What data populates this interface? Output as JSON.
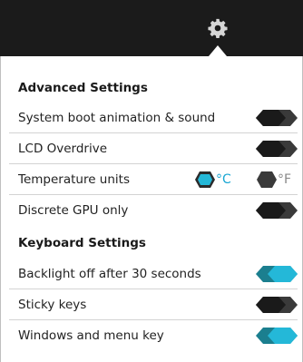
{
  "header": {
    "icon": "gear-icon"
  },
  "sections": {
    "advanced": {
      "title": "Advanced Settings"
    },
    "keyboard": {
      "title": "Keyboard Settings"
    }
  },
  "settings": {
    "boot_animation": {
      "label": "System boot animation & sound",
      "on": false
    },
    "lcd_overdrive": {
      "label": "LCD Overdrive",
      "on": false
    },
    "temperature": {
      "label": "Temperature units",
      "celsius": "°C",
      "fahrenheit": "°F",
      "selected": "°C"
    },
    "discrete_gpu": {
      "label": "Discrete GPU only",
      "on": false
    },
    "backlight_off": {
      "label": "Backlight off after 30 seconds",
      "on": true
    },
    "sticky_keys": {
      "label": "Sticky keys",
      "on": false
    },
    "windows_menu_key": {
      "label": "Windows and menu key",
      "on": true
    }
  },
  "colors": {
    "header_bg": "#1b1b1b",
    "toggle_off": "#3a3a3a",
    "toggle_on": "#1b7f8f",
    "knob_on": "#24b8d8",
    "knob_off": "#1a1a1a",
    "accent_text": "#1aa7d3",
    "inactive_text": "#8a8a8a"
  }
}
